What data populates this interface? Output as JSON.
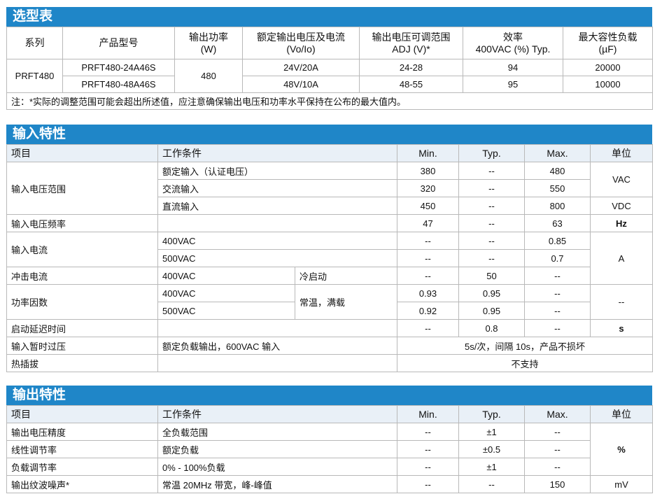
{
  "selection": {
    "title": "选型表",
    "headers": {
      "series": "系列",
      "model": "产品型号",
      "power": [
        "输出功率",
        "(W)"
      ],
      "voltage_current": [
        "额定输出电压及电流",
        "(Vo/Io)"
      ],
      "adj": [
        "输出电压可调范围",
        "ADJ (V)*"
      ],
      "efficiency": [
        "效率",
        "400VAC (%) Typ."
      ],
      "cap": [
        "最大容性负载",
        "(µF)"
      ]
    },
    "series_value": "PRFT480",
    "power_value": "480",
    "rows": [
      {
        "model": "PRFT480-24A46S",
        "vo": "24V/20A",
        "adj": "24-28",
        "eff": "94",
        "cap": "20000"
      },
      {
        "model": "PRFT480-48A46S",
        "vo": "48V/10A",
        "adj": "48-55",
        "eff": "95",
        "cap": "10000"
      }
    ],
    "note": "注：*实际的调整范围可能会超出所述值，应注意确保输出电压和功率水平保持在公布的最大值内。"
  },
  "input": {
    "title": "输入特性",
    "headers": {
      "item": "项目",
      "cond": "工作条件",
      "min": "Min.",
      "typ": "Typ.",
      "max": "Max.",
      "unit": "单位"
    },
    "voltage_range": {
      "label": "输入电压范围",
      "rows": [
        {
          "cond": "额定输入（认证电压）",
          "min": "380",
          "typ": "--",
          "max": "480"
        },
        {
          "cond": "交流输入",
          "min": "320",
          "typ": "--",
          "max": "550"
        },
        {
          "cond": "直流输入",
          "min": "450",
          "typ": "--",
          "max": "800"
        }
      ],
      "unit_ac": "VAC",
      "unit_dc": "VDC"
    },
    "frequency": {
      "label": "输入电压频率",
      "min": "47",
      "typ": "--",
      "max": "63",
      "unit": "Hz"
    },
    "current": {
      "label": "输入电流",
      "rows": [
        {
          "cond": "400VAC",
          "min": "--",
          "typ": "--",
          "max": "0.85"
        },
        {
          "cond": "500VAC",
          "min": "--",
          "typ": "--",
          "max": "0.7"
        }
      ],
      "unit": "A"
    },
    "inrush": {
      "label": "冲击电流",
      "cond": "400VAC",
      "cond2": "冷启动",
      "min": "--",
      "typ": "50",
      "max": "--"
    },
    "pf": {
      "label": "功率因数",
      "cond2": "常温，满载",
      "rows": [
        {
          "cond": "400VAC",
          "min": "0.93",
          "typ": "0.95",
          "max": "--"
        },
        {
          "cond": "500VAC",
          "min": "0.92",
          "typ": "0.95",
          "max": "--"
        }
      ],
      "unit": "--"
    },
    "delay": {
      "label": "启动延迟时间",
      "min": "--",
      "typ": "0.8",
      "max": "--",
      "unit": "s"
    },
    "surge": {
      "label": "输入暂时过压",
      "cond": "额定负载输出，600VAC 输入",
      "value": "5s/次，间隔 10s，产品不损坏"
    },
    "hotplug": {
      "label": "热插拔",
      "value": "不支持"
    }
  },
  "output": {
    "title": "输出特性",
    "headers": {
      "item": "项目",
      "cond": "工作条件",
      "min": "Min.",
      "typ": "Typ.",
      "max": "Max.",
      "unit": "单位"
    },
    "rows": [
      {
        "label": "输出电压精度",
        "cond": "全负载范围",
        "min": "--",
        "typ": "±1",
        "max": "--"
      },
      {
        "label": "线性调节率",
        "cond": "额定负载",
        "min": "--",
        "typ": "±0.5",
        "max": "--"
      },
      {
        "label": "负载调节率",
        "cond": "0% - 100%负载",
        "min": "--",
        "typ": "±1",
        "max": "--"
      }
    ],
    "pct_unit": "%",
    "ripple": {
      "label": "输出纹波噪声*",
      "cond": "常温 20MHz 带宽，峰-峰值",
      "min": "--",
      "typ": "--",
      "max": "150",
      "unit": "mV"
    }
  }
}
